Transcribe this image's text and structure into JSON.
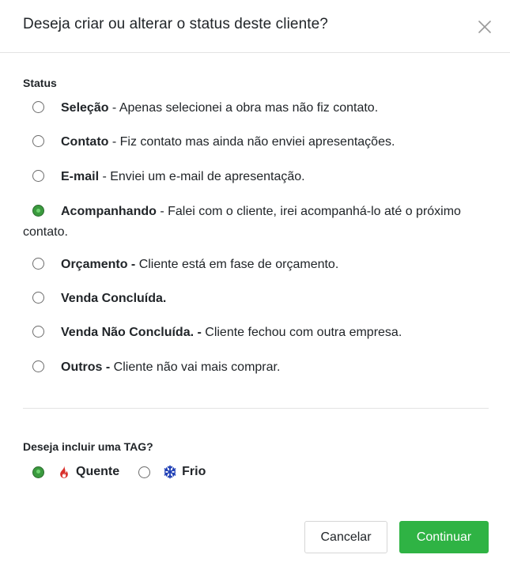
{
  "modal": {
    "title": "Deseja criar ou alterar o status deste cliente?",
    "close_icon": "close-icon"
  },
  "status_section": {
    "label": "Status",
    "selected": "Acompanhando",
    "options": [
      {
        "name": "Seleção",
        "description": " - Apenas selecionei a obra mas não fiz contato.",
        "checked": false
      },
      {
        "name": "Contato",
        "description": " - Fiz contato mas ainda não enviei apresentações.",
        "checked": false
      },
      {
        "name": "E-mail",
        "description": " - Enviei um e-mail de apresentação.",
        "checked": false
      },
      {
        "name": "Acompanhando",
        "description": " - Falei com o cliente, irei acompanhá-lo até o próximo contato.",
        "checked": true
      },
      {
        "name": "Orçamento -",
        "description": " Cliente está em fase de orçamento.",
        "checked": false
      },
      {
        "name": "Venda Concluída.",
        "description": "",
        "checked": false
      },
      {
        "name": "Venda Não Concluída. -",
        "description": " Cliente fechou com outra empresa.",
        "checked": false
      },
      {
        "name": "Outros -",
        "description": " Cliente não vai mais comprar.",
        "checked": false
      }
    ]
  },
  "tag_section": {
    "label": "Deseja incluir uma TAG?",
    "selected": "Quente",
    "options": [
      {
        "label": "Quente",
        "icon": "fire-icon",
        "color": "#d9302c",
        "checked": true
      },
      {
        "label": "Frio",
        "icon": "snowflake-icon",
        "color": "#1f3fb5",
        "checked": false
      }
    ]
  },
  "footer": {
    "cancel_label": "Cancelar",
    "continue_label": "Continuar"
  },
  "colors": {
    "primary_green": "#2fb344",
    "radio_checked": "#3a9a3e",
    "divider": "#e3e3e3"
  }
}
